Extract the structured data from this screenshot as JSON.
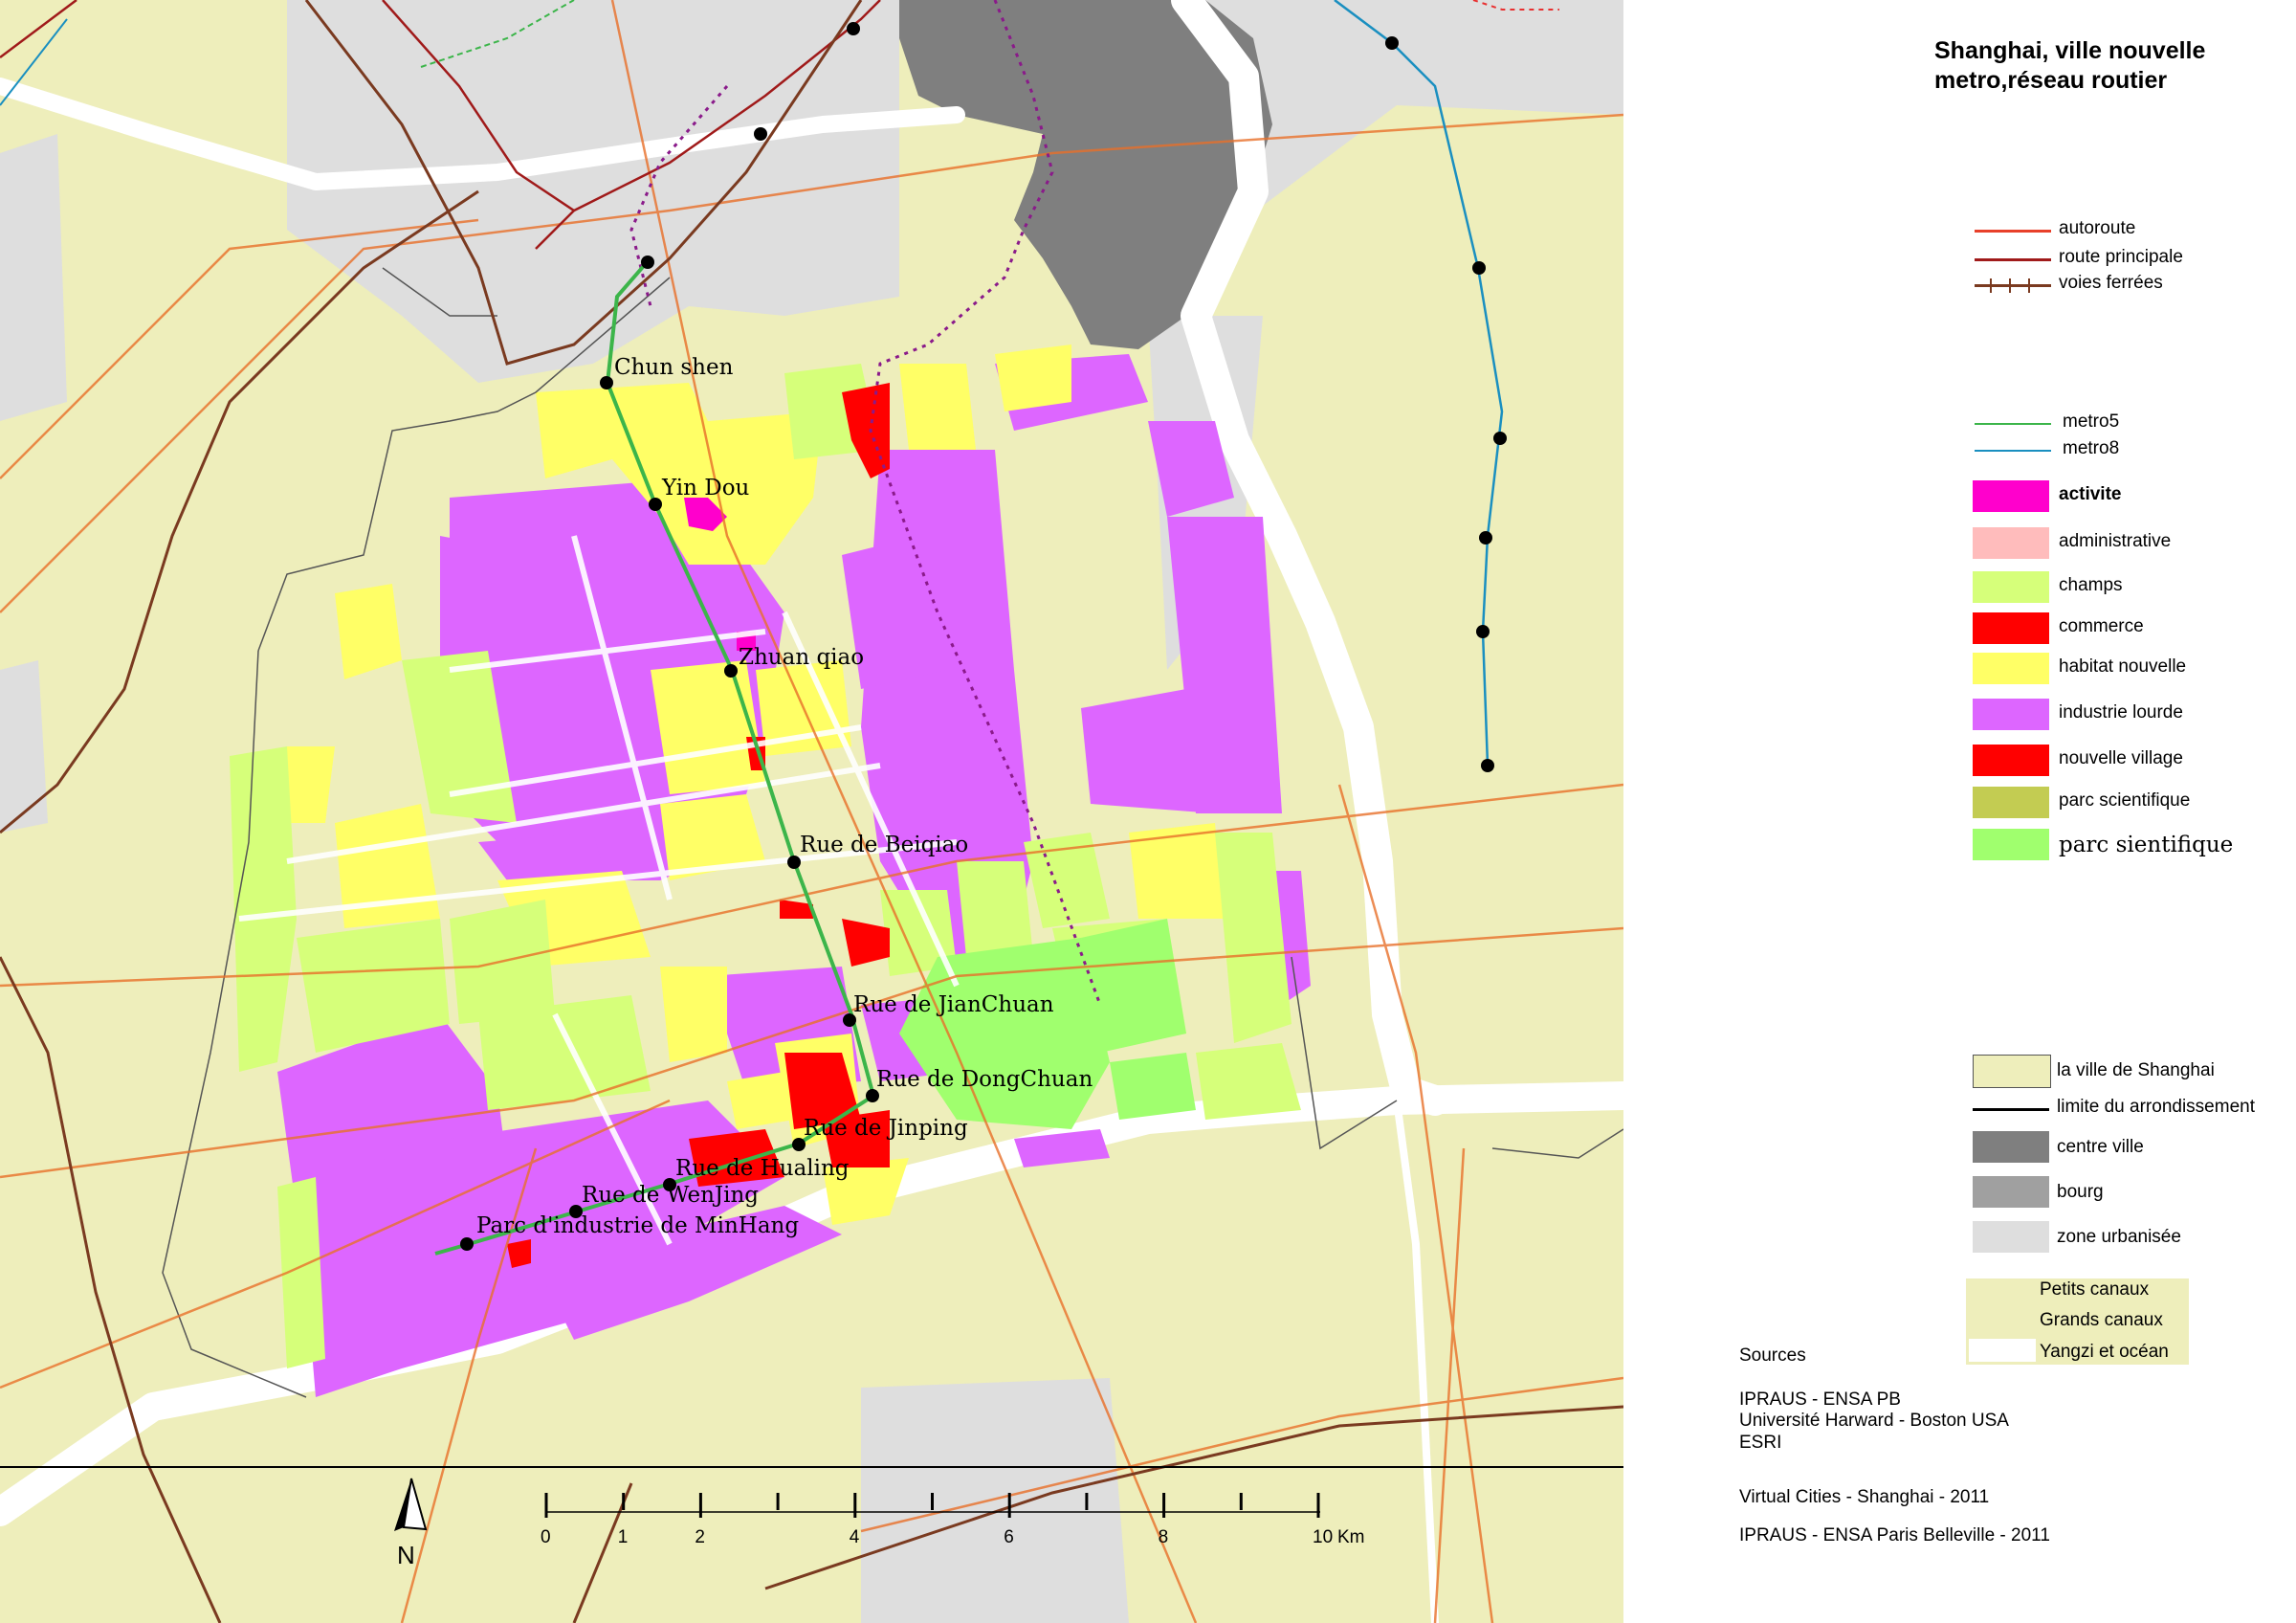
{
  "title": [
    "Shanghai, ville nouvelle",
    "metro,réseau routier"
  ],
  "legend_lines": [
    {
      "label": "autoroute",
      "color": "#e8402a",
      "weight": "normal",
      "size": 19
    },
    {
      "label": "route principale",
      "color": "#a01a1a",
      "weight": "normal",
      "size": 19
    },
    {
      "label": "voies ferrées",
      "color": "#7a3a20",
      "weight": "normal",
      "size": 19
    }
  ],
  "legend_metro": [
    {
      "label": "metro5",
      "color": "#3cb54a"
    },
    {
      "label": "metro8",
      "color": "#1a8fc0"
    }
  ],
  "legend_zones": [
    {
      "label": "activite",
      "color": "#ff00cc",
      "weight": "bold",
      "font": "Liberation Sans"
    },
    {
      "label": "administrative",
      "color": "#ffbcbc",
      "weight": "normal",
      "font": "Liberation Sans"
    },
    {
      "label": "champs",
      "color": "#d6ff7a",
      "weight": "normal",
      "font": "Liberation Sans"
    },
    {
      "label": "commerce",
      "color": "#ff0000",
      "weight": "normal",
      "font": "Liberation Sans"
    },
    {
      "label": "habitat nouvelle",
      "color": "#ffff66",
      "weight": "normal",
      "font": "Liberation Sans"
    },
    {
      "label": "industrie lourde",
      "color": "#dd66ff",
      "weight": "normal",
      "font": "Liberation Sans"
    },
    {
      "label": "nouvelle village",
      "color": "#ff0000",
      "weight": "normal",
      "font": "Liberation Sans"
    },
    {
      "label": "parc scientifique",
      "color": "#c3cc52",
      "weight": "normal",
      "font": "Liberation Sans"
    },
    {
      "label": "parc sientifique",
      "color": "#a0ff6e",
      "weight": "normal",
      "font": "DejaVu Serif"
    }
  ],
  "legend_base": [
    {
      "label": "la ville de Shanghai",
      "color": "#eeeebb",
      "kind": "box"
    },
    {
      "label": "limite du arrondissement",
      "color": "#000000",
      "kind": "line"
    },
    {
      "label": "centre ville",
      "color": "#7f7f7f",
      "kind": "box"
    },
    {
      "label": "bourg",
      "color": "#a0a0a0",
      "kind": "box"
    },
    {
      "label": "zone urbanisée",
      "color": "#dedede",
      "kind": "box"
    }
  ],
  "legend_water": [
    {
      "label": "Petits canaux"
    },
    {
      "label": "Grands canaux"
    },
    {
      "label": "Yangzi et océan"
    }
  ],
  "sources": {
    "heading": "Sources",
    "lines": [
      "IPRAUS - ENSA PB",
      "Université Harward - Boston USA",
      "ESRI"
    ]
  },
  "footer": [
    "Virtual Cities - Shanghai - 2011",
    "IPRAUS - ENSA Paris Belleville - 2011"
  ],
  "scale": {
    "ticks": [
      "0",
      "1",
      "2",
      "4",
      "6",
      "8",
      "10"
    ],
    "unit": "Km"
  },
  "north_label": "N",
  "stations": [
    {
      "name": "Chun shen"
    },
    {
      "name": "Yin Dou"
    },
    {
      "name": "Zhuan qiao"
    },
    {
      "name": "Rue de Beiqiao"
    },
    {
      "name": "Rue de JianChuan"
    },
    {
      "name": "Rue de DongChuan"
    },
    {
      "name": "Rue de Jinping"
    },
    {
      "name": "Rue de Hualing"
    },
    {
      "name": "Rue de WenJing"
    },
    {
      "name": "Parc d'industrie de MinHang"
    }
  ],
  "colors": {
    "background": "#eeeebb",
    "urban": "#dedede",
    "centre": "#7f7f7f",
    "water": "#ffffff",
    "industry": "#dd66ff",
    "housing": "#ffff66",
    "fields": "#d6ff7a",
    "park": "#a0ff6e",
    "commerce": "#ff0000",
    "activity": "#ff00cc",
    "metro5": "#3cb54a",
    "metro8": "#1a8fc0",
    "highway": "#e8402a",
    "mainroad": "#a01a1a",
    "rail": "#7a3a20"
  }
}
